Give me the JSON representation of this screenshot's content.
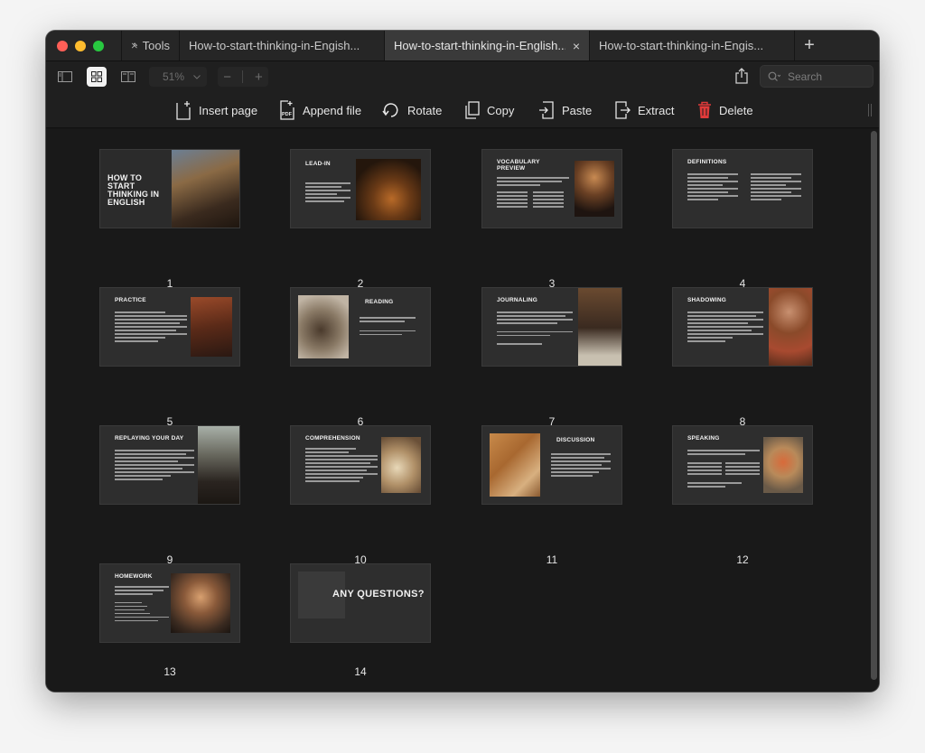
{
  "tabs": {
    "tools_label": "Tools",
    "docs": [
      {
        "label": "How-to-start-thinking-in-Engish...",
        "active": false
      },
      {
        "label": "How-to-start-thinking-in-English...",
        "active": true
      },
      {
        "label": "How-to-start-thinking-in-Engis...",
        "active": false
      }
    ],
    "close_glyph": "×",
    "new_tab_glyph": "+"
  },
  "viewbar": {
    "zoom": "51%",
    "zoom_out": "−",
    "zoom_in": "+",
    "search_placeholder": "Search"
  },
  "actions": {
    "insert": "Insert page",
    "append": "Append file",
    "rotate": "Rotate",
    "copy": "Copy",
    "paste": "Paste",
    "extract": "Extract",
    "delete": "Delete"
  },
  "pages": [
    {
      "num": "1",
      "title": "HOW TO START THINKING IN ENGLISH"
    },
    {
      "num": "2",
      "title": "LEAD-IN"
    },
    {
      "num": "3",
      "title": "VOCABULARY PREVIEW"
    },
    {
      "num": "4",
      "title": "DEFINITIONS"
    },
    {
      "num": "5",
      "title": "PRACTICE"
    },
    {
      "num": "6",
      "title": "READING"
    },
    {
      "num": "7",
      "title": "JOURNALING"
    },
    {
      "num": "8",
      "title": "SHADOWING"
    },
    {
      "num": "9",
      "title": "REPLAYING YOUR DAY"
    },
    {
      "num": "10",
      "title": "COMPREHENSION"
    },
    {
      "num": "11",
      "title": "DISCUSSION"
    },
    {
      "num": "12",
      "title": "SPEAKING"
    },
    {
      "num": "13",
      "title": "HOMEWORK"
    },
    {
      "num": "14",
      "title": "ANY QUESTIONS?"
    }
  ],
  "colors": {
    "window_bg": "#171717",
    "active_tab": "#3a3a3a",
    "delete_accent": "#e03a3a",
    "slide_bg": "#2e2e2e"
  }
}
